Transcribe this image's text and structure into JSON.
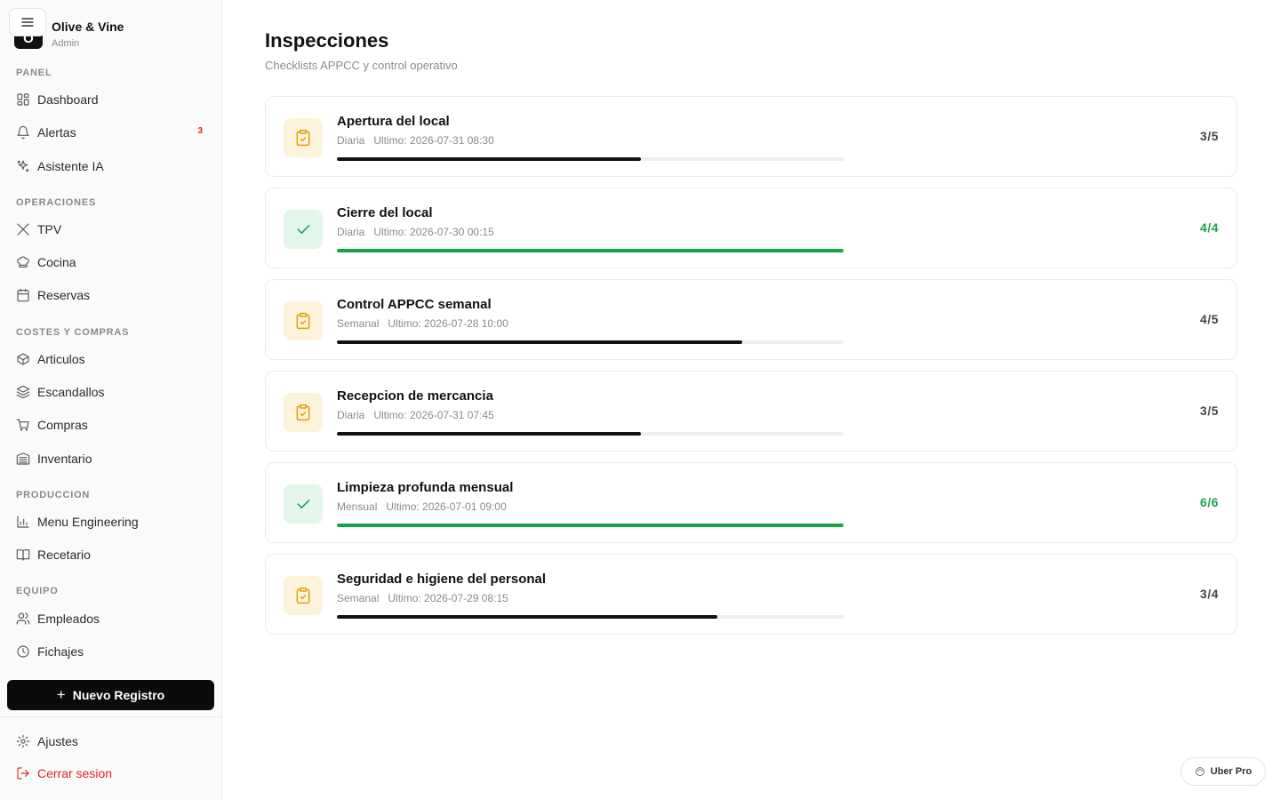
{
  "brand": {
    "name": "Olive & Vine",
    "role": "Admin",
    "logo_letter": "O"
  },
  "sidebar": {
    "sections": [
      {
        "label": "PANEL",
        "items": [
          {
            "label": "Dashboard",
            "icon": "dashboard-icon"
          },
          {
            "label": "Alertas",
            "icon": "bell-icon",
            "badge": "3"
          },
          {
            "label": "Asistente IA",
            "icon": "sparkles-icon"
          }
        ]
      },
      {
        "label": "OPERACIONES",
        "items": [
          {
            "label": "TPV",
            "icon": "utensils-icon"
          },
          {
            "label": "Cocina",
            "icon": "chef-hat-icon"
          },
          {
            "label": "Reservas",
            "icon": "calendar-icon"
          }
        ]
      },
      {
        "label": "COSTES Y COMPRAS",
        "items": [
          {
            "label": "Articulos",
            "icon": "package-icon"
          },
          {
            "label": "Escandallos",
            "icon": "layers-icon"
          },
          {
            "label": "Compras",
            "icon": "cart-icon"
          },
          {
            "label": "Inventario",
            "icon": "warehouse-icon"
          }
        ]
      },
      {
        "label": "PRODUCCION",
        "items": [
          {
            "label": "Menu Engineering",
            "icon": "bar-chart-icon"
          },
          {
            "label": "Recetario",
            "icon": "book-icon"
          }
        ]
      },
      {
        "label": "EQUIPO",
        "items": [
          {
            "label": "Empleados",
            "icon": "users-icon"
          },
          {
            "label": "Fichajes",
            "icon": "clock-icon"
          }
        ]
      }
    ],
    "new_button": "Nuevo Registro",
    "settings": "Ajustes",
    "logout": "Cerrar sesion"
  },
  "page": {
    "title": "Inspecciones",
    "subtitle": "Checklists APPCC y control operativo"
  },
  "inspections": [
    {
      "title": "Apertura del local",
      "frequency": "Diaria",
      "last": "Ultimo: 2026-07-31 08:30",
      "done": 3,
      "total": 5,
      "count": "3/5",
      "status": "pending"
    },
    {
      "title": "Cierre del local",
      "frequency": "Diaria",
      "last": "Ultimo: 2026-07-30 00:15",
      "done": 4,
      "total": 4,
      "count": "4/4",
      "status": "complete"
    },
    {
      "title": "Control APPCC semanal",
      "frequency": "Semanal",
      "last": "Ultimo: 2026-07-28 10:00",
      "done": 4,
      "total": 5,
      "count": "4/5",
      "status": "pending"
    },
    {
      "title": "Recepcion de mercancia",
      "frequency": "Diaria",
      "last": "Ultimo: 2026-07-31 07:45",
      "done": 3,
      "total": 5,
      "count": "3/5",
      "status": "pending"
    },
    {
      "title": "Limpieza profunda mensual",
      "frequency": "Mensual",
      "last": "Ultimo: 2026-07-01 09:00",
      "done": 6,
      "total": 6,
      "count": "6/6",
      "status": "complete"
    },
    {
      "title": "Seguridad e higiene del personal",
      "frequency": "Semanal",
      "last": "Ultimo: 2026-07-29 08:15",
      "done": 3,
      "total": 4,
      "count": "3/4",
      "status": "pending"
    }
  ],
  "floating_badge": "Uber Pro",
  "colors": {
    "accent": "#111111",
    "success": "#16a34a",
    "pending_icon": "#e0a100",
    "danger": "#dc2626"
  }
}
